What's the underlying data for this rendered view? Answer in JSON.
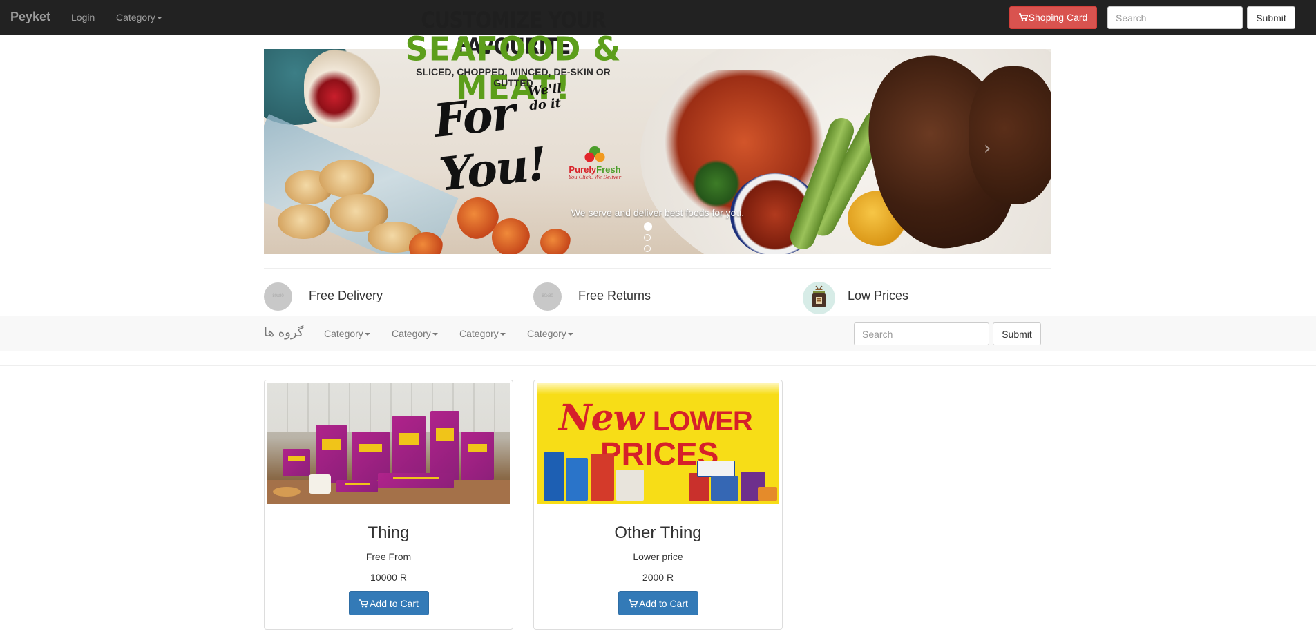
{
  "topnav": {
    "brand": "Peyket",
    "login": "Login",
    "category": "Category",
    "cart_label": "Shoping Card",
    "search_placeholder": "Search",
    "submit_label": "Submit"
  },
  "carousel": {
    "banner": {
      "line1": "CUSTOMIZE YOUR FAVOURITE",
      "line2": "SEAFOOD & MEAT!",
      "line3": "SLICED, CHOPPED, MINCED, DE-SKIN OR GUTTED",
      "script1": "We'll do it",
      "script2": "For You!",
      "logo_part1": "Purely",
      "logo_part2": "Fresh",
      "logo_tagline": "You Click. We Deliver"
    },
    "caption": "We serve and deliver best foods for you.",
    "indicator_count": 3,
    "active_index": 0
  },
  "features": [
    {
      "title": "Free Delivery",
      "icon": "placeholder-image-icon",
      "icon_text": "80x80"
    },
    {
      "title": "Free Returns",
      "icon": "placeholder-image-icon",
      "icon_text": "80x80"
    },
    {
      "title": "Low Prices",
      "icon": "tea-bag-icon"
    }
  ],
  "subnav": {
    "brand": "گروه ها",
    "categories": [
      "Category",
      "Category",
      "Category",
      "Category"
    ],
    "search_placeholder": "Search",
    "submit_label": "Submit"
  },
  "products": [
    {
      "title": "Thing",
      "description": "Free From",
      "price": "10000 R",
      "button": "Add to Cart"
    },
    {
      "title": "Other Thing",
      "description": "Lower price",
      "price": "2000 R",
      "button": "Add to Cart",
      "image_text": {
        "new": "New",
        "lower": "LOWER",
        "prices": "PRICES"
      }
    }
  ],
  "colors": {
    "navbar_bg": "#222222",
    "cart_button": "#d9534f",
    "primary_button": "#337ab7",
    "banner_green": "#5c9e1b",
    "lower_prices_yellow": "#f7dd17",
    "lower_prices_red": "#d6202a"
  }
}
